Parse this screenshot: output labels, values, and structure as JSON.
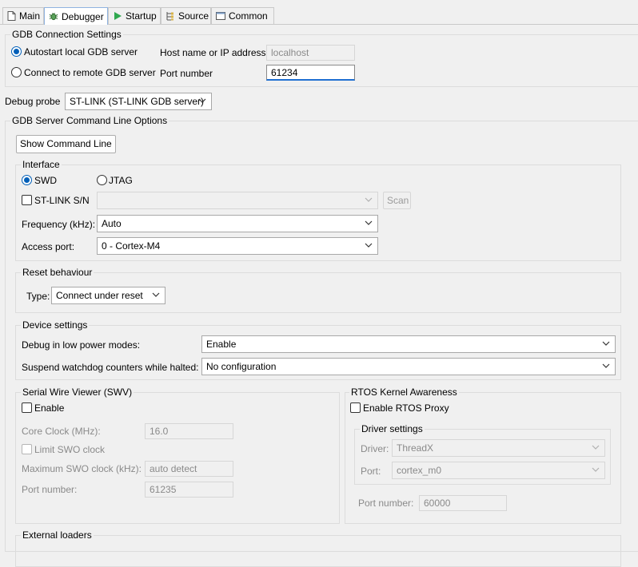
{
  "tabs": [
    {
      "label": "Main",
      "icon": "main-file-icon"
    },
    {
      "label": "Debugger",
      "icon": "debugger-bug-icon",
      "active": true
    },
    {
      "label": "Startup",
      "icon": "startup-play-icon"
    },
    {
      "label": "Source",
      "icon": "source-folder-icon"
    },
    {
      "label": "Common",
      "icon": "common-window-icon"
    }
  ],
  "gdb": {
    "title": "GDB Connection Settings",
    "autostart_label": "Autostart local GDB server",
    "remote_label": "Connect to remote GDB server",
    "host_label": "Host name or IP address",
    "host_value": "localhost",
    "port_label": "Port number",
    "port_value": "61234"
  },
  "probe": {
    "label": "Debug probe",
    "value": "ST-LINK (ST-LINK GDB server)"
  },
  "server": {
    "title": "GDB Server Command Line Options",
    "show_cmd_label": "Show Command Line",
    "interface": {
      "title": "Interface",
      "swd_label": "SWD",
      "jtag_label": "JTAG",
      "sn_label": "ST-LINK S/N",
      "sn_value": "",
      "scan_label": "Scan",
      "freq_label": "Frequency (kHz):",
      "freq_value": "Auto",
      "access_label": "Access port:",
      "access_value": "0 - Cortex-M4"
    },
    "reset": {
      "title": "Reset behaviour",
      "type_label": "Type:",
      "type_value": "Connect under reset"
    },
    "device": {
      "title": "Device settings",
      "lowpower_label": "Debug in low power modes:",
      "lowpower_value": "Enable",
      "watchdog_label": "Suspend watchdog counters while halted:",
      "watchdog_value": "No configuration"
    },
    "swv": {
      "title": "Serial Wire Viewer (SWV)",
      "enable_label": "Enable",
      "core_label": "Core Clock (MHz):",
      "core_value": "16.0",
      "limit_label": "Limit SWO clock",
      "max_label": "Maximum SWO clock (kHz):",
      "max_value": "auto detect",
      "port_label": "Port number:",
      "port_value": "61235"
    },
    "rtos": {
      "title": "RTOS Kernel Awareness",
      "enable_label": "Enable RTOS Proxy",
      "driver_title": "Driver settings",
      "driver_label": "Driver:",
      "driver_value": "ThreadX",
      "port_label": "Port:",
      "port_value": "cortex_m0",
      "portnum_label": "Port number:",
      "portnum_value": "60000"
    },
    "loaders": {
      "title": "External loaders"
    }
  },
  "colors": {
    "accent": "#005fb8",
    "focus_underline": "#1f6fd1"
  }
}
